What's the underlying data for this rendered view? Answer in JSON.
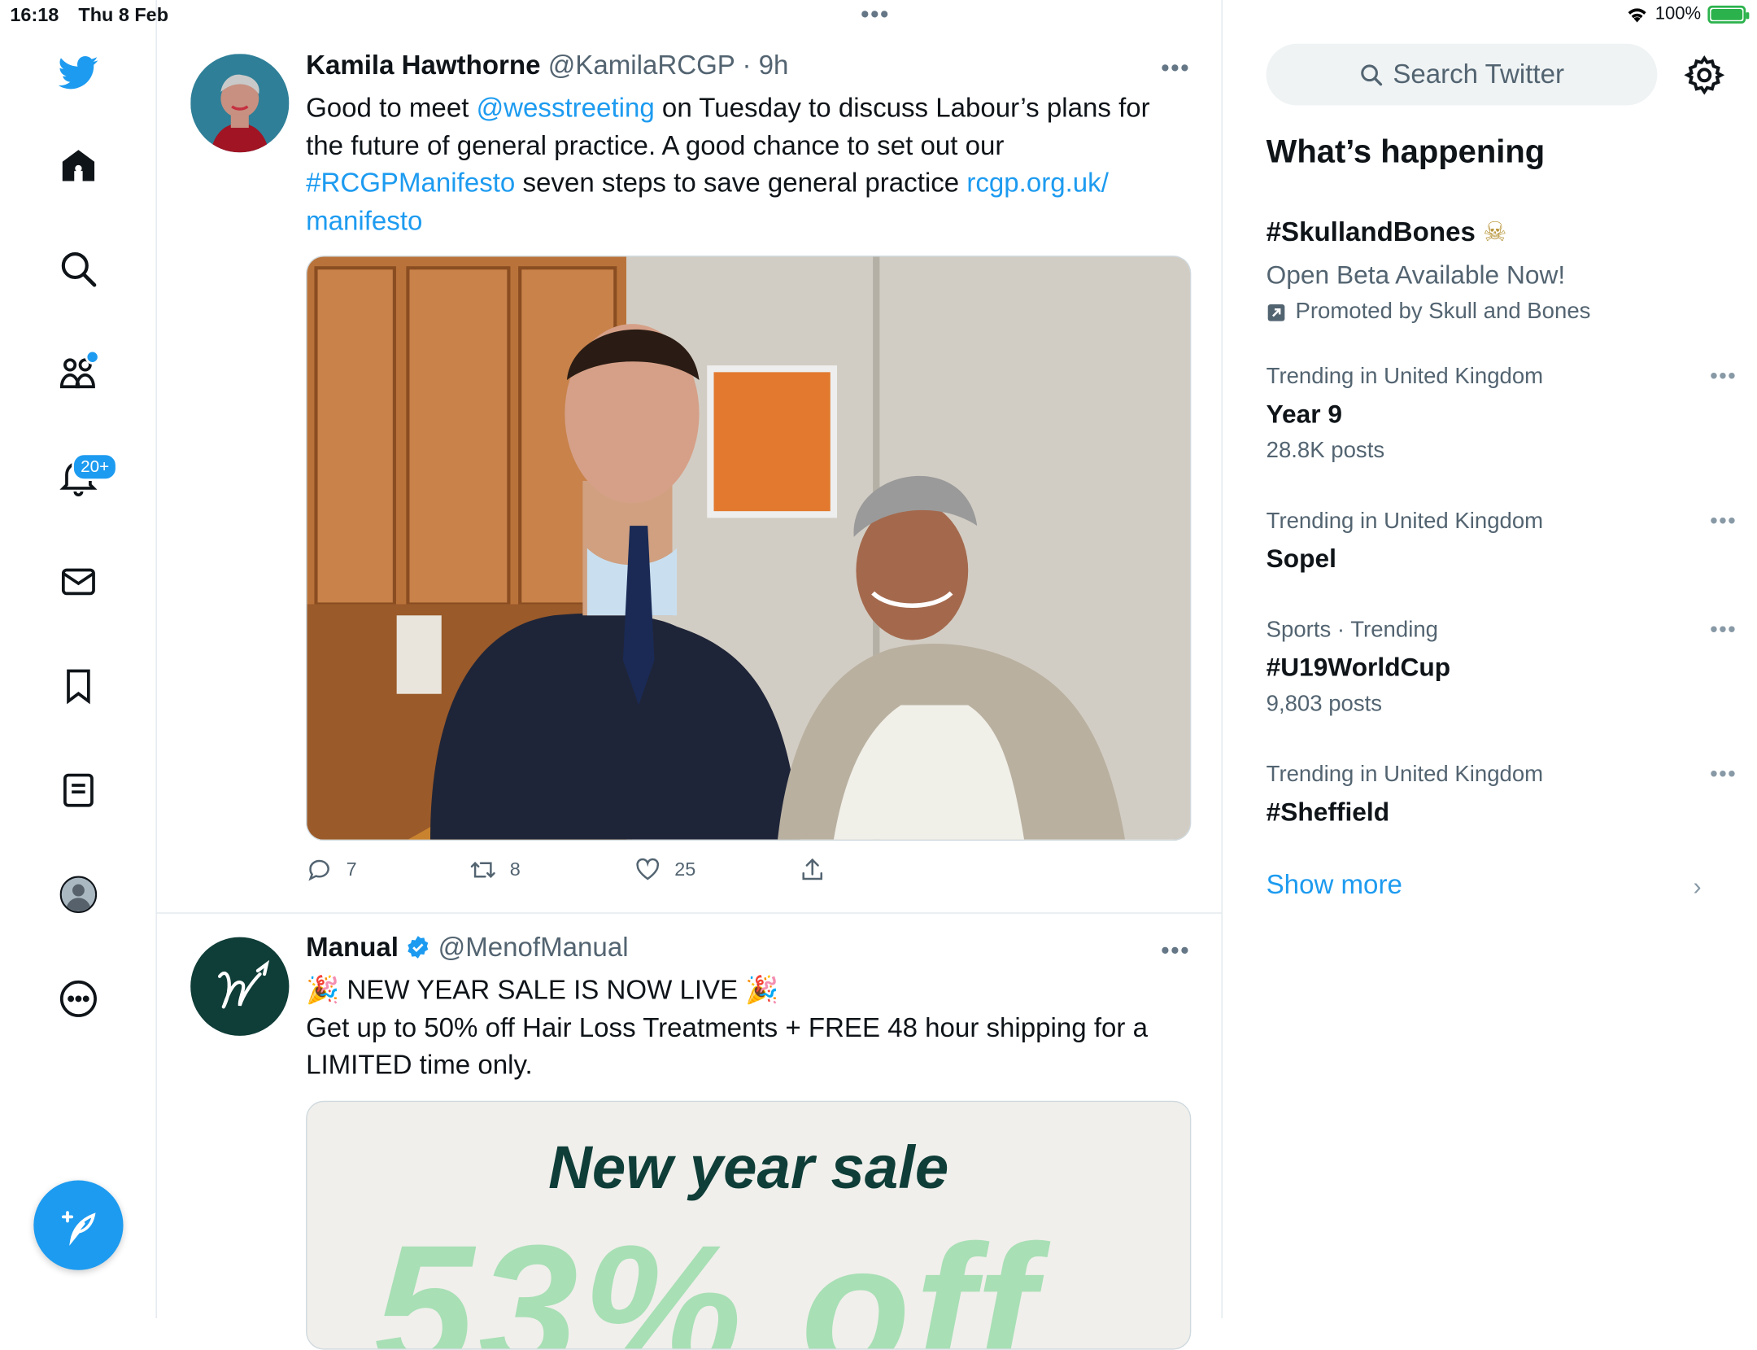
{
  "status_bar": {
    "time": "16:18",
    "date": "Thu 8 Feb",
    "battery_text": "100%",
    "battery_level": 1.0
  },
  "nav": {
    "notifications_badge": "20+"
  },
  "tweets": [
    {
      "name": "Kamila Hawthorne",
      "handle": "@KamilaRCGP",
      "time": "· 9h",
      "text_parts": [
        "Good to meet ",
        "@wesstreeting",
        " on Tuesday to discuss Labour’s plans for the future of general practice. A good chance to set out our ",
        "#RCGPManifesto",
        " seven steps to save general practice ",
        "rcgp.org.uk/ manifesto"
      ],
      "replies": "7",
      "retweets": "8",
      "likes": "25"
    },
    {
      "name": "Manual",
      "handle": "@MenofManual",
      "line1": "🎉 NEW YEAR SALE IS NOW LIVE 🎉",
      "line2": "Get up to 50% off Hair Loss Treatments + FREE 48 hour shipping for a LIMITED time only.",
      "ad_headline": "New year sale",
      "ad_offer": "53% off"
    }
  ],
  "sidebar": {
    "search_placeholder": "Search Twitter",
    "title": "What’s happening",
    "promoted": {
      "name": "#SkullandBones",
      "emoji": "☠",
      "subtitle": "Open Beta Available Now!",
      "promoted_by": "Promoted by Skull and Bones"
    },
    "trends": [
      {
        "meta": "Trending in United Kingdom",
        "name": "Year 9",
        "count": "28.8K posts"
      },
      {
        "meta": "Trending in United Kingdom",
        "name": "Sopel",
        "count": ""
      },
      {
        "meta": "Sports · Trending",
        "name": "#U19WorldCup",
        "count": "9,803 posts"
      },
      {
        "meta": "Trending in United Kingdom",
        "name": "#Sheffield",
        "count": ""
      }
    ],
    "show_more": "Show more"
  },
  "colors": {
    "accent": "#1d9bf0",
    "text": "#0f1419",
    "muted": "#536471"
  }
}
